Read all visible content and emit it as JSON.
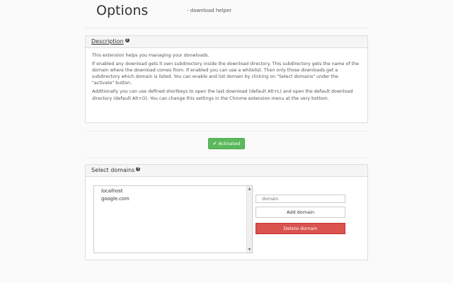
{
  "header": {
    "title": "Options",
    "subtitle": "- download helper"
  },
  "description": {
    "heading": "Description",
    "help_icon": "question-circle-icon",
    "paragraphs": [
      "This extension helps you managing your donwloads.",
      "If enabled any download gets it own subdirectory inside the download directory. This subdirectory gets the name of the domain where the download comes from. If enabled you can use a whitelist. Then only those downloads get a subdirectory which domain is listed. You can enable and list domain by clicking on \"Select domains\" under the \"activate\" button.",
      "Additionally you can use defined shortkeys to open the last download (default Alt+L) and open the default download directory (default Alt+O). You can change this settings in the Chrome extension menu at the very bottom."
    ]
  },
  "activate": {
    "label": "Activated",
    "icon": "check-icon",
    "color": "#5cb85c"
  },
  "domains": {
    "heading": "Select domains",
    "help_icon": "question-circle-icon",
    "list": [
      "localhost",
      "google.com"
    ],
    "input_placeholder": "domain",
    "add_label": "Add domain",
    "delete_label": "Delete domain",
    "delete_color": "#d9534f"
  }
}
